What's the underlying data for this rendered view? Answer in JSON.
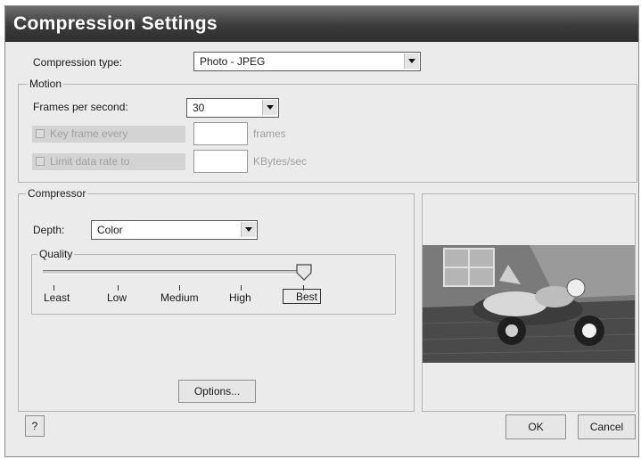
{
  "window": {
    "title": "Compression Settings"
  },
  "compression_type": {
    "label": "Compression type:",
    "value": "Photo - JPEG"
  },
  "motion": {
    "legend": "Motion",
    "fps_label": "Frames per second:",
    "fps_value": "30",
    "key_frame_label": "Key frame every",
    "key_frame_value": "",
    "key_frame_unit": "frames",
    "limit_label": "Limit data rate to",
    "limit_value": "",
    "limit_unit": "KBytes/sec"
  },
  "compressor": {
    "legend": "Compressor",
    "depth_label": "Depth:",
    "depth_value": "Color",
    "quality": {
      "legend": "Quality",
      "marks": [
        "Least",
        "Low",
        "Medium",
        "High",
        "Best"
      ],
      "selected": "Best",
      "level": 1.0
    },
    "options_label": "Options..."
  },
  "footer": {
    "help_label": "?",
    "ok_label": "OK",
    "cancel_label": "Cancel"
  },
  "colors": {
    "title_bar": "#3a3a3a",
    "dialog_bg": "#ebebeb"
  }
}
